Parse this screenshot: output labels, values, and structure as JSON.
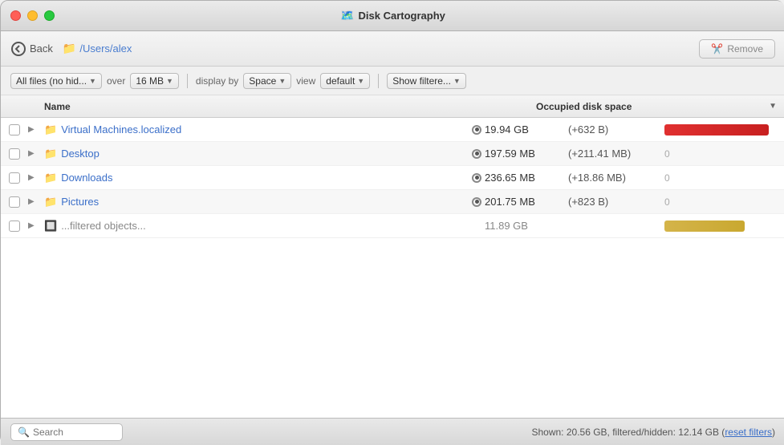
{
  "app": {
    "title": "Disk Cartography",
    "title_icon": "🗺️"
  },
  "toolbar": {
    "back_label": "Back",
    "path": "/Users/alex",
    "path_icon": "📁",
    "remove_label": "Remove",
    "remove_icon": "✂️"
  },
  "filter_bar": {
    "files_filter_label": "All files (no hid...",
    "over_label": "over",
    "size_value": "16 MB",
    "display_by_label": "display by",
    "space_value": "Space",
    "view_label": "view",
    "view_value": "default",
    "show_filter_label": "Show filtere..."
  },
  "table": {
    "col_name": "Name",
    "col_size": "Occupied disk space",
    "rows": [
      {
        "name": "Virtual Machines.localized",
        "size": "19.94 GB",
        "delta": "(+632 B)",
        "bar_type": "red",
        "has_radio": true,
        "folder_color": "blue"
      },
      {
        "name": "Desktop",
        "size": "197.59 MB",
        "delta": "(+211.41 MB)",
        "bar_type": "none",
        "has_radio": true,
        "folder_color": "blue",
        "extra": "0"
      },
      {
        "name": "Downloads",
        "size": "236.65 MB",
        "delta": "(+18.86 MB)",
        "bar_type": "none",
        "has_radio": true,
        "folder_color": "blue",
        "extra": "0"
      },
      {
        "name": "Pictures",
        "size": "201.75 MB",
        "delta": "(+823 B)",
        "bar_type": "none",
        "has_radio": true,
        "folder_color": "blue",
        "extra": "0"
      },
      {
        "name": "...filtered objects...",
        "size": "11.89 GB",
        "delta": "",
        "bar_type": "yellow",
        "has_radio": false,
        "folder_color": "special",
        "extra": ""
      }
    ]
  },
  "status": {
    "shown": "Shown: 20.56 GB, filtered/hidden: 12.14 GB (",
    "reset_label": "reset filters",
    "shown_after": ")"
  },
  "search": {
    "placeholder": "Search"
  }
}
